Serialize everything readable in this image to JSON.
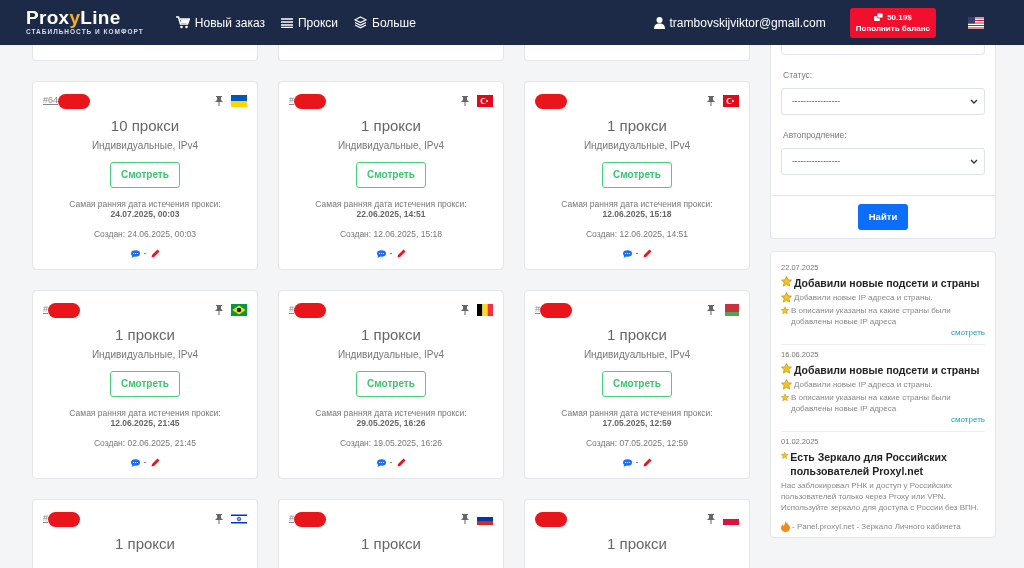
{
  "brand": {
    "name_a": "Prox",
    "name_b": "y",
    "name_c": "Line",
    "tagline": "СТАБИЛЬНОСТЬ И КОМФОРТ"
  },
  "nav": [
    {
      "label": "Новый заказ"
    },
    {
      "label": "Прокси"
    },
    {
      "label": "Больше"
    }
  ],
  "user": {
    "email": "trambovskijviktor@gmail.com"
  },
  "balance": {
    "amount": "50.19$",
    "label": "Пополнить баланс"
  },
  "orders": [
    {
      "kind": "full",
      "id": "#64",
      "count": "10 прокси",
      "type": "Индивидуальные, IPv4",
      "button": "Смотреть",
      "expiry_label": "Самая ранняя дата истечения прокси:",
      "expiry": "24.07.2025, 00:03",
      "created": "Создан: 24.06.2025, 00:03",
      "note": "-"
    },
    {
      "kind": "full",
      "id": "#",
      "count": "1 прокси",
      "type": "Индивидуальные, IPv4",
      "button": "Смотреть",
      "expiry_label": "Самая ранняя дата истечения прокси:",
      "expiry": "22.06.2025, 14:51",
      "created": "Создан: 12.06.2025, 15:18",
      "note": "-"
    },
    {
      "kind": "full",
      "count": "1 прокси",
      "type": "Индивидуальные, IPv4",
      "button": "Смотреть",
      "expiry_label": "Самая ранняя дата истечения прокси:",
      "expiry": "12.06.2025, 15:18",
      "created": "Создан: 12.06.2025, 14:51",
      "note": "-"
    },
    {
      "kind": "full",
      "id": "#",
      "count": "1 прокси",
      "type": "Индивидуальные, IPv4",
      "button": "Смотреть",
      "expiry_label": "Самая ранняя дата истечения прокси:",
      "expiry": "12.06.2025, 21:45",
      "created": "Создан: 02.06.2025, 21:45",
      "note": "-"
    },
    {
      "kind": "full",
      "id": "#",
      "count": "1 прокси",
      "type": "Индивидуальные, IPv4",
      "button": "Смотреть",
      "expiry_label": "Самая ранняя дата истечения прокси:",
      "expiry": "29.05.2025, 16:26",
      "created": "Создан: 19.05.2025, 16:26",
      "note": "-"
    },
    {
      "kind": "full",
      "id": "#",
      "count": "1 прокси",
      "type": "Индивидуальные, IPv4",
      "button": "Смотреть",
      "expiry_label": "Самая ранняя дата истечения прокси:",
      "expiry": "17.05.2025, 12:59",
      "created": "Создан: 07.05.2025, 12:59",
      "note": "-"
    },
    {
      "kind": "cut",
      "id": "#",
      "count": "1 прокси"
    },
    {
      "kind": "cut",
      "id": "#",
      "count": "1 прокси"
    },
    {
      "kind": "cut",
      "count": "1 прокси"
    }
  ],
  "filter": {
    "fields": [
      {
        "label": "Статус:",
        "value": "-----------------"
      },
      {
        "label": "Автопродление:",
        "value": "-----------------"
      }
    ],
    "button": "Найти"
  },
  "news": [
    {
      "date": "22.07.2025",
      "title": "Добавили новые подсети и страны",
      "lines": [
        {
          "star": true,
          "text": "Добавили новые IP адреса и страны."
        },
        {
          "star": true,
          "text": "В описании указаны на какие страны были добавлены новые IP адреса"
        }
      ],
      "link": "смотреть"
    },
    {
      "date": "16.06.2025",
      "title": "Добавили новые подсети и страны",
      "lines": [
        {
          "star": true,
          "text": "Добавили новые IP адреса и страны."
        },
        {
          "star": true,
          "text": "В описании указаны на какие страны были добавлены новые IP адреса"
        }
      ],
      "link": "смотреть"
    },
    {
      "date": "01.02.2025",
      "title": "Есть Зеркало для Российских пользователей Proxyl.net",
      "lines": [
        {
          "star": false,
          "text": "Нас заблокировал РНК и доступ у Российских пользователей только через Proxy или VPN. Используйте зеркало для доступа с России без ВПН."
        }
      ],
      "fire": "-  Panel.proxyl.net - Зеркало Личного кабинета"
    }
  ]
}
